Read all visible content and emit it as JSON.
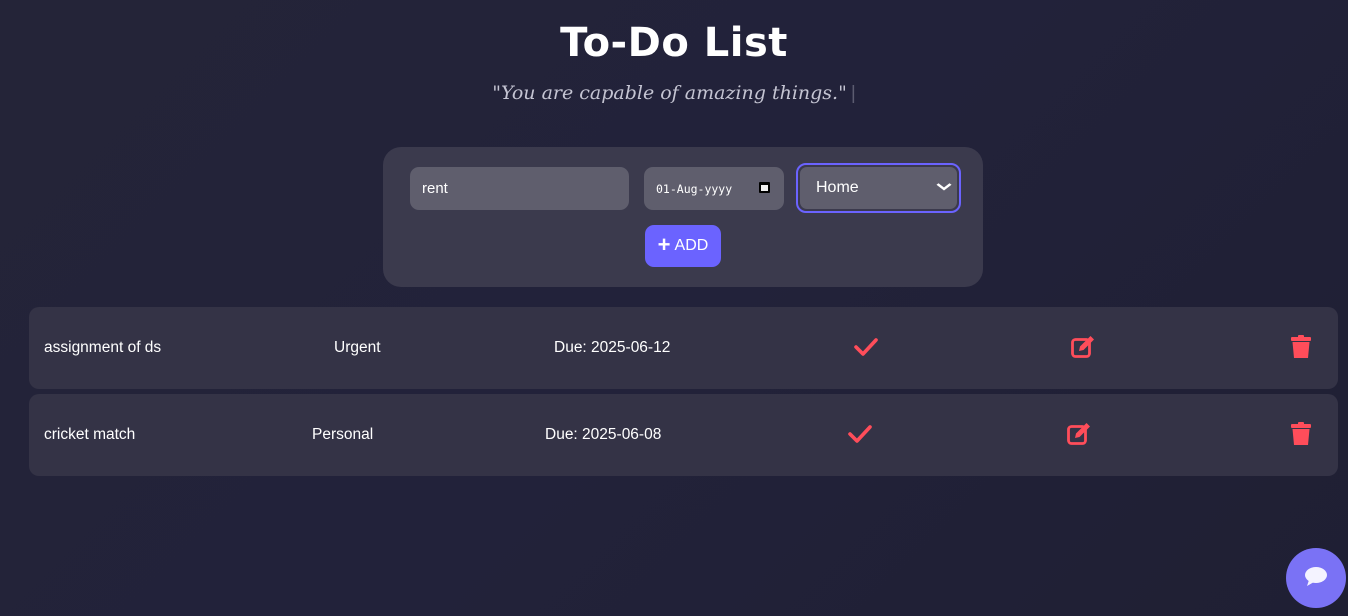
{
  "header": {
    "title": "To-Do List",
    "quote": "\"You are capable of amazing things.\"",
    "cursor": "|"
  },
  "form": {
    "task_value": "rent",
    "date_value": "01-Aug-yyyy",
    "category_value": "Home",
    "add_label": "ADD",
    "add_icon": "+"
  },
  "tasks": [
    {
      "name": "assignment of ds",
      "category": "Urgent",
      "due": "Due: 2025-06-12"
    },
    {
      "name": "cricket match",
      "category": "Personal",
      "due": "Due: 2025-06-08"
    }
  ],
  "icons": {
    "complete": "check-icon",
    "edit": "edit-icon",
    "delete": "trash-icon",
    "chat": "chat-bubble-icon"
  },
  "colors": {
    "accent": "#6b63ff",
    "action_icon": "#ff4d5a",
    "card": "#343346",
    "background": "#22223a"
  }
}
